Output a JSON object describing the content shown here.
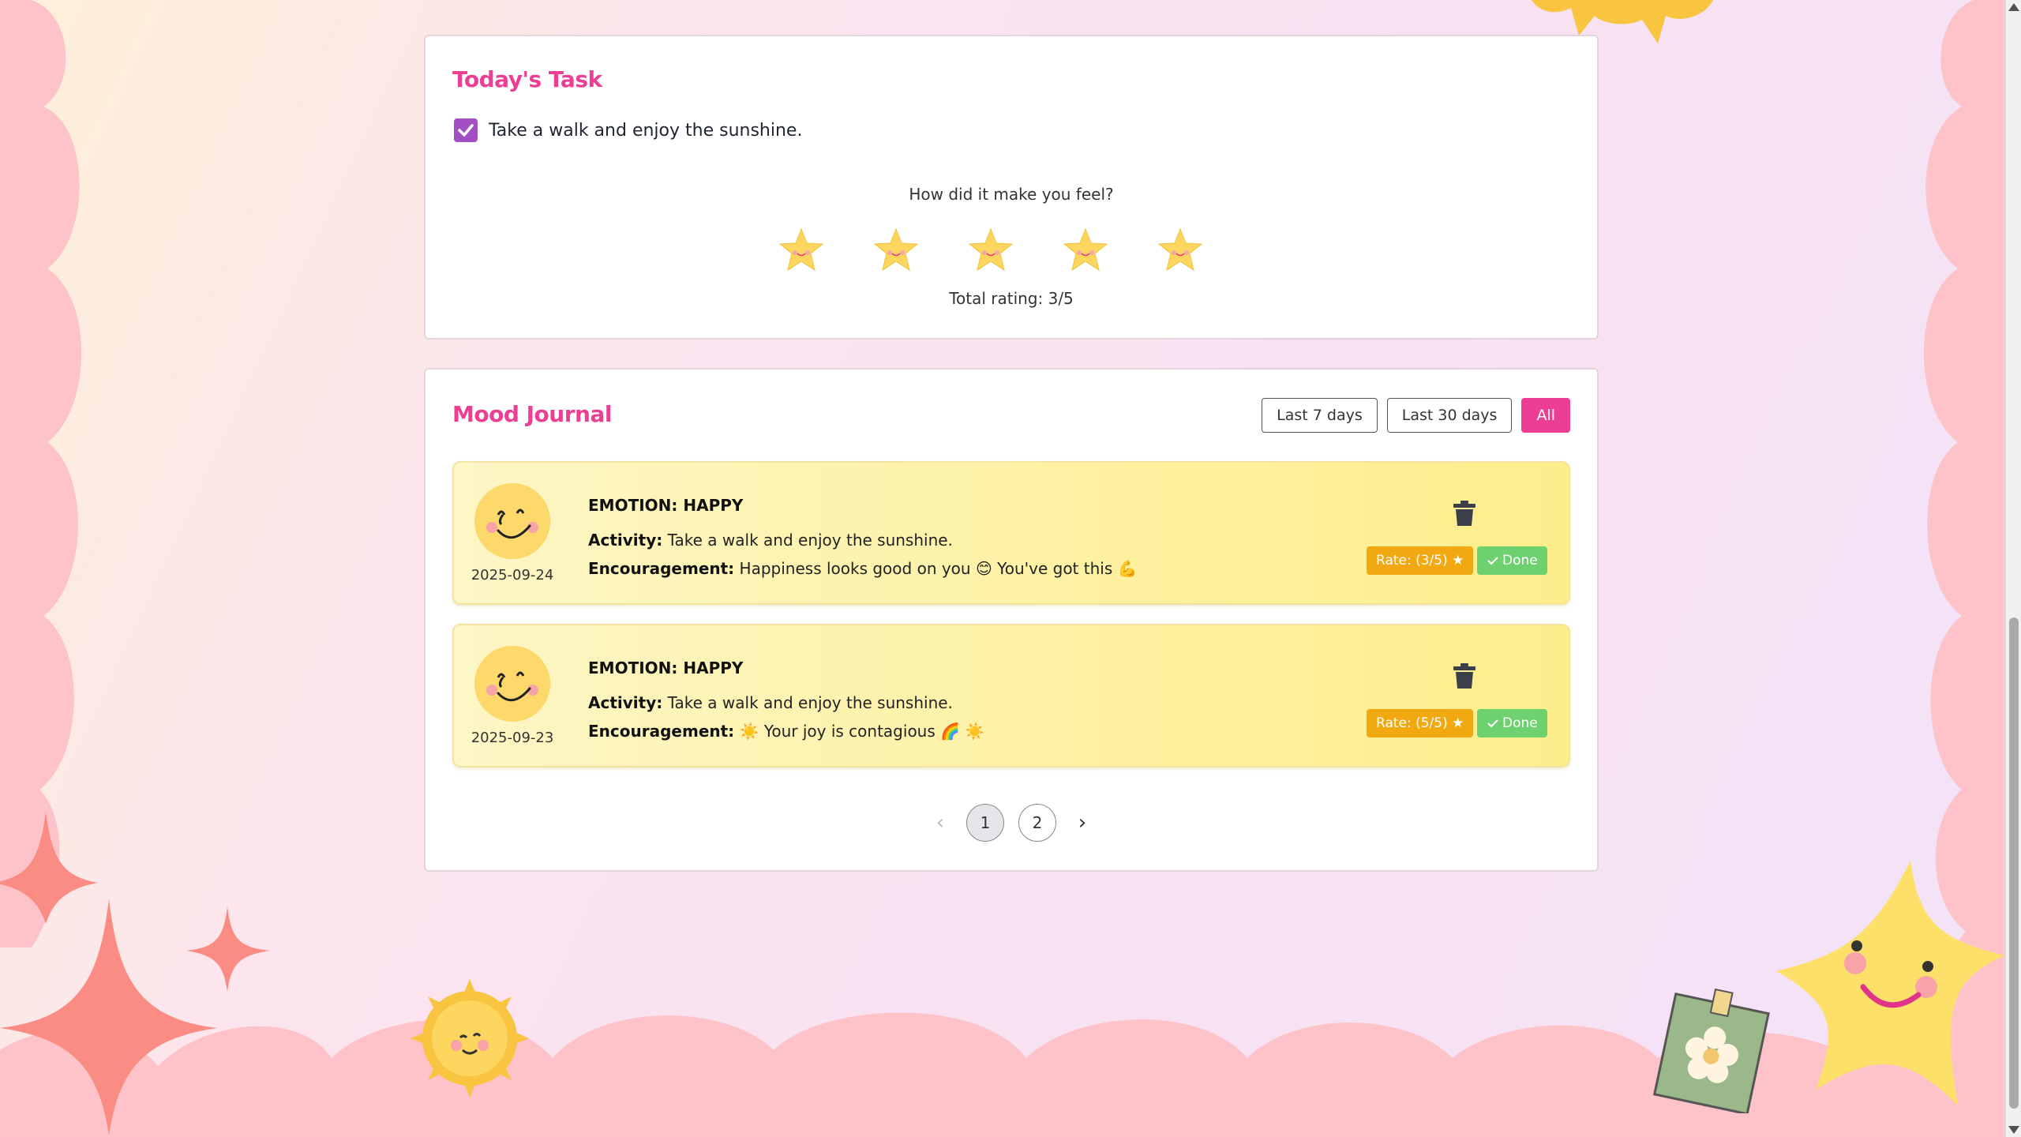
{
  "task": {
    "title": "Today's Task",
    "task_text": "Take a walk and enjoy the sunshine.",
    "checked": true,
    "feel_prompt": "How did it make you feel?",
    "stars": 5,
    "total_rating": "Total rating: 3/5"
  },
  "journal": {
    "title": "Mood Journal",
    "filters": [
      "Last 7 days",
      "Last 30 days",
      "All"
    ],
    "active_filter": "All",
    "entries": [
      {
        "emotion": "EMOTION: HAPPY",
        "activity_label": "Activity:",
        "activity": "Take a walk and enjoy the sunshine.",
        "encourage_label": "Encouragement:",
        "encouragement": "Happiness looks good on you 😊 You've got this 💪",
        "date": "2025-09-24",
        "rate": "Rate: (3/5) ★",
        "done": "Done"
      },
      {
        "emotion": "EMOTION: HAPPY",
        "activity_label": "Activity:",
        "activity": "Take a walk and enjoy the sunshine.",
        "encourage_label": "Encouragement:",
        "encouragement": "☀️ Your joy is contagious 🌈 ☀️",
        "date": "2025-09-23",
        "rate": "Rate: (5/5) ★",
        "done": "Done"
      }
    ],
    "pagination": {
      "prev": "‹",
      "pages": [
        "1",
        "2"
      ],
      "current": "1",
      "next": "›"
    }
  },
  "colors": {
    "accent": "#ec3f93",
    "checkbox": "#a24ec4",
    "rate_badge": "#f2a810",
    "done_badge": "#6ed170"
  }
}
